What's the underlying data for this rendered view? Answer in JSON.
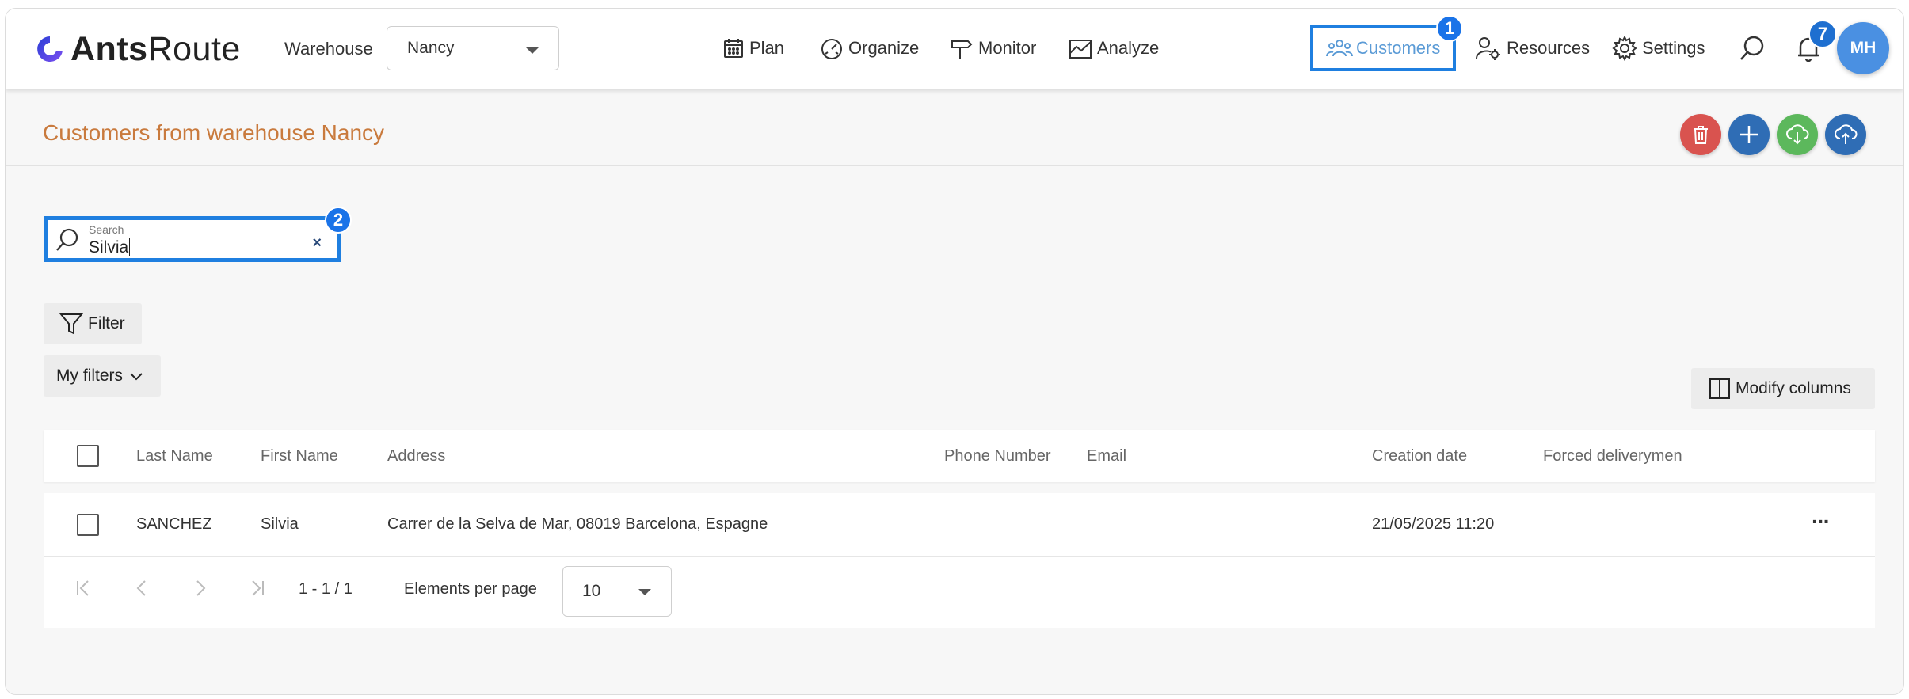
{
  "header": {
    "logo": {
      "bold": "Ants",
      "regular": "Route"
    },
    "warehouse_label": "Warehouse",
    "warehouse_value": "Nancy",
    "nav": {
      "plan": "Plan",
      "organize": "Organize",
      "monitor": "Monitor",
      "analyze": "Analyze",
      "customers": "Customers",
      "resources": "Resources",
      "settings": "Settings"
    },
    "annotation_1": "1",
    "notification_count": "7",
    "avatar_initials": "MH"
  },
  "page": {
    "title": "Customers from warehouse Nancy",
    "colors": {
      "title": "#c97a3d",
      "delete": "#d9534f",
      "add": "#2f6db5",
      "import": "#5cb85c",
      "export": "#2f6db5"
    }
  },
  "search": {
    "label": "Search",
    "value": "Silvia",
    "clear_glyph": "×",
    "annotation_2": "2"
  },
  "filters": {
    "filter_label": "Filter",
    "my_filters_label": "My filters",
    "modify_columns_label": "Modify columns"
  },
  "table": {
    "columns": [
      "Last Name",
      "First Name",
      "Address",
      "Phone Number",
      "Email",
      "Creation date",
      "Forced deliverymen"
    ],
    "rows": [
      {
        "last_name": "SANCHEZ",
        "first_name": "Silvia",
        "address": "Carrer de la Selva de Mar, 08019 Barcelona, Espagne",
        "phone": "",
        "email": "",
        "creation_date": "21/05/2025 11:20",
        "forced_deliverymen": ""
      }
    ],
    "more_glyph": "···"
  },
  "pagination": {
    "range": "1 - 1 / 1",
    "per_page_label": "Elements per page",
    "per_page_value": "10"
  }
}
